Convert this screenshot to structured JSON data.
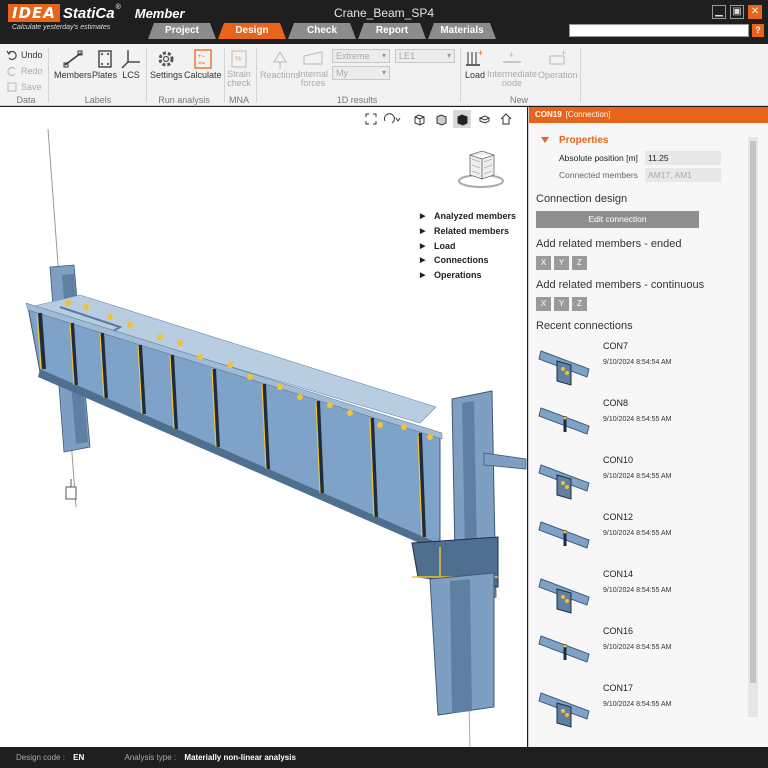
{
  "app": {
    "logo_idea": "IDEA",
    "logo_statica": "StatiCa",
    "logo_reg": "®",
    "product": "Member",
    "tagline": "Calculate yesterday's estimates",
    "document_title": "Crane_Beam_SP4"
  },
  "tabs": [
    {
      "label": "Project",
      "active": false
    },
    {
      "label": "Design",
      "active": true
    },
    {
      "label": "Check",
      "active": false
    },
    {
      "label": "Report",
      "active": false
    },
    {
      "label": "Materials",
      "active": false
    }
  ],
  "search": {
    "placeholder": ""
  },
  "help_label": "?",
  "ribbon": {
    "data": {
      "undo": "Undo",
      "redo": "Redo",
      "save": "Save",
      "group": "Data"
    },
    "labels": {
      "members": "Members",
      "plates": "Plates",
      "lcs": "LCS",
      "group": "Labels"
    },
    "run_analysis": {
      "settings": "Settings",
      "calculate": "Calculate",
      "group": "Run analysis"
    },
    "mna": {
      "strain_check": "Strain check",
      "group": "MNA"
    },
    "results_1d": {
      "reactions": "Reactions",
      "internal_forces": "Internal forces",
      "combo_extreme": "Extreme",
      "combo_my": "My",
      "combo_le": "LE1",
      "group": "1D results"
    },
    "new": {
      "load": "Load",
      "intermediate_node": "Intermediate node",
      "operation": "Operation",
      "group": "New"
    }
  },
  "viewport": {
    "legend": [
      "Analyzed members",
      "Related members",
      "Load",
      "Connections",
      "Operations"
    ]
  },
  "panel": {
    "header_id": "CON19",
    "header_type": "[Connection]",
    "properties_title": "Properties",
    "absolute_position_label": "Absolute position [m]",
    "absolute_position_value": "11.25",
    "connected_members_label": "Connected members",
    "connected_members_value": "AM17, AM1",
    "connection_design_title": "Connection design",
    "edit_connection_label": "Edit connection",
    "related_ended_title": "Add related members - ended",
    "related_continuous_title": "Add related members - continuous",
    "axes": [
      "X",
      "Y",
      "Z"
    ],
    "recent_title": "Recent connections",
    "recent": [
      {
        "name": "CON7",
        "date": "9/10/2024 8:54:54 AM"
      },
      {
        "name": "CON8",
        "date": "9/10/2024 8:54:55 AM"
      },
      {
        "name": "CON10",
        "date": "9/10/2024 8:54:55 AM"
      },
      {
        "name": "CON12",
        "date": "9/10/2024 8:54:55 AM"
      },
      {
        "name": "CON14",
        "date": "9/10/2024 8:54:55 AM"
      },
      {
        "name": "CON16",
        "date": "9/10/2024 8:54:55 AM"
      },
      {
        "name": "CON17",
        "date": "9/10/2024 8:54:55 AM"
      }
    ]
  },
  "status": {
    "design_code_label": "Design code :",
    "design_code_value": "EN",
    "analysis_type_label": "Analysis type :",
    "analysis_type_value": "Materially non-linear analysis"
  },
  "colors": {
    "accent": "#e8641b",
    "steel": "#7fa3c8",
    "steel_dark": "#4f6f91",
    "bolt": "#f2c230"
  }
}
